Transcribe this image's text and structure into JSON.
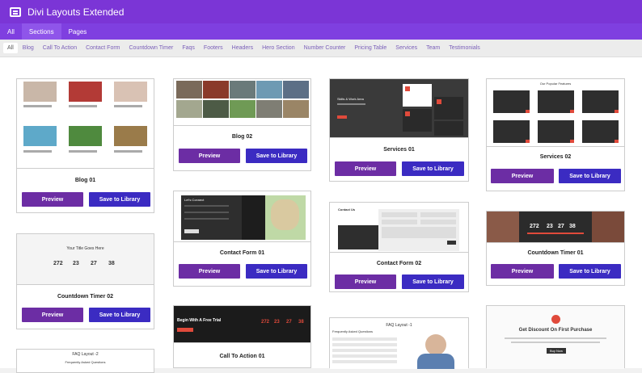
{
  "app": {
    "title": "Divi Layouts Extended",
    "icon": "layout-icon"
  },
  "tabs": [
    {
      "label": "All",
      "active": false
    },
    {
      "label": "Sections",
      "active": true
    },
    {
      "label": "Pages",
      "active": false
    }
  ],
  "filters": [
    "All",
    "Blog",
    "Call To Action",
    "Contact Form",
    "Countdown Timer",
    "Faqs",
    "Footers",
    "Headers",
    "Hero Section",
    "Number Counter",
    "Pricing Table",
    "Services",
    "Team",
    "Testimonials"
  ],
  "buttons": {
    "preview": "Preview",
    "save": "Save to Library"
  },
  "cards": {
    "blog01": {
      "title": "Blog 01"
    },
    "countdown02": {
      "title": "Countdown Timer 02",
      "heading": "Your Title Goes Here",
      "digits": [
        "272",
        "23",
        "27",
        "38"
      ]
    },
    "faq2": {
      "heading": "FAQ Layout -2",
      "sub": "Frequently Asked Questions"
    },
    "blog02": {
      "title": "Blog 02"
    },
    "contact01": {
      "title": "Contact Form 01",
      "heading": "Let's Connect"
    },
    "cta01": {
      "title": "Call To Action 01",
      "heading": "Begin With A Free Trial",
      "digits": [
        "272",
        "23",
        "27",
        "38"
      ]
    },
    "services01": {
      "title": "Services 01",
      "heading": "Skills & Work Area"
    },
    "contact02": {
      "title": "Contact Form 02",
      "heading": "Contact Us"
    },
    "faq1": {
      "heading": "FAQ Layout -1",
      "sub": "Frequently Asked Questions"
    },
    "services02": {
      "title": "Services 02",
      "heading": "Our Popular Features"
    },
    "countdown01": {
      "title": "Countdown Timer 01",
      "digits": [
        "272",
        "23",
        "27",
        "38"
      ]
    },
    "discount": {
      "heading": "Get Discount On First Purchase",
      "button": "Buy Now"
    }
  }
}
